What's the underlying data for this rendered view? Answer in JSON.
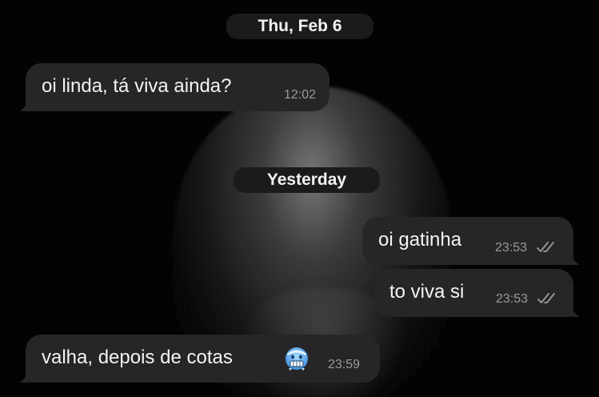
{
  "chat": {
    "date_separators": [
      {
        "label": "Thu, Feb 6"
      },
      {
        "label": "Yesterday"
      }
    ],
    "messages": [
      {
        "direction": "incoming",
        "text": "oi linda, tá viva ainda?",
        "time": "12:02"
      },
      {
        "direction": "outgoing",
        "text": "oi gatinha",
        "time": "23:53",
        "status_icon": "double-check-icon"
      },
      {
        "direction": "outgoing",
        "text": "to viva si",
        "time": "23:53",
        "status_icon": "double-check-icon"
      },
      {
        "direction": "incoming",
        "text": "valha, depois de cotas",
        "emoji_icon": "cold-face-emoji-icon",
        "time": "23:59"
      }
    ]
  },
  "colors": {
    "background": "#000000",
    "bubble": "#262628",
    "date_pill": "#1b1b1b",
    "timestamp": "#9a9a9a"
  }
}
